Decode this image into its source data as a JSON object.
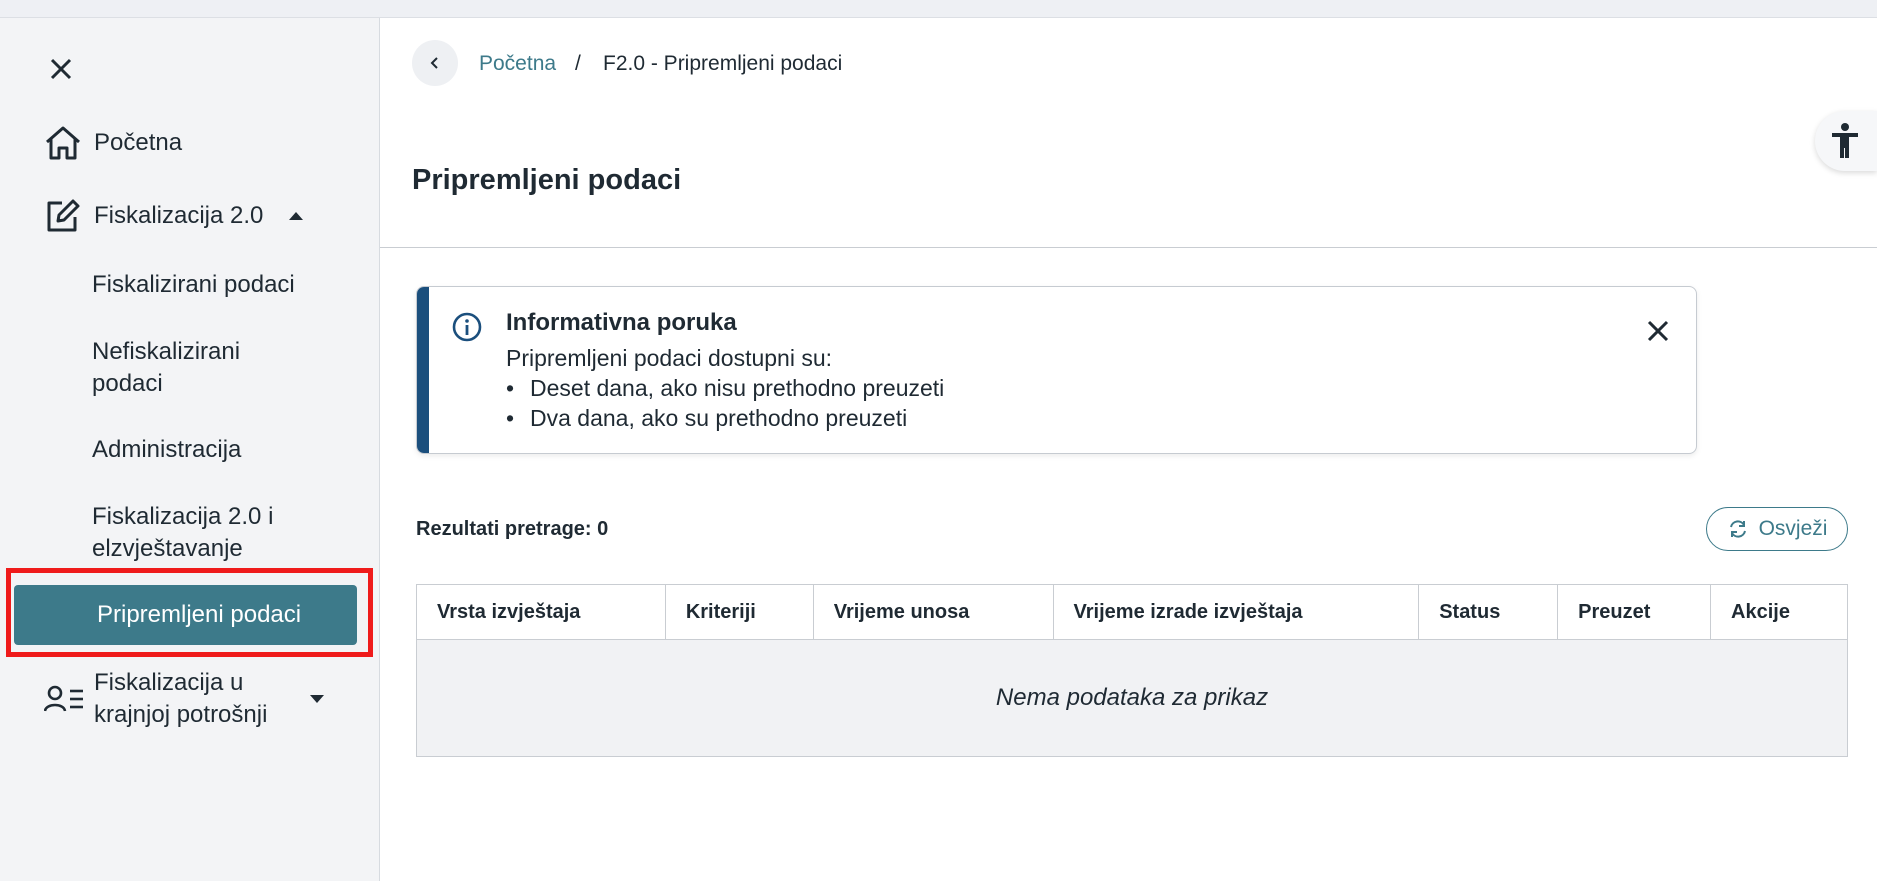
{
  "sidebar": {
    "nav_home": "Početna",
    "nav_fisk20": "Fiskalizacija 2.0",
    "sub_items": [
      "Fiskalizirani podaci",
      "Nefiskalizirani podaci",
      "Administracija",
      "Fiskalizacija 2.0 i elzvještavanje"
    ],
    "active_item": "Pripremljeni podaci",
    "nav_end_consumption": "Fiskalizacija u krajnjoj potrošnji",
    "icons": [
      "close-icon",
      "home-icon",
      "edit-icon",
      "user-list-icon"
    ]
  },
  "breadcrumb": {
    "home": "Početna",
    "separator": "/",
    "current": "F2.0 - Pripremljeni podaci"
  },
  "page": {
    "title": "Pripremljeni podaci"
  },
  "info_message": {
    "title": "Informativna poruka",
    "intro": "Pripremljeni podaci dostupni su:",
    "bullets": [
      "Deset dana, ako nisu prethodno preuzeti",
      "Dva dana, ako su prethodno preuzeti"
    ]
  },
  "results": {
    "label": "Rezultati pretrage: 0",
    "refresh_label": "Osvježi"
  },
  "table": {
    "columns": [
      "Vrsta izvještaja",
      "Kriteriji",
      "Vrijeme unosa",
      "Vrijeme izrade izvještaja",
      "Status",
      "Preuzet",
      "Akcije"
    ],
    "empty_text": "Nema podataka za prikaz"
  },
  "colors": {
    "accent": "#3d7a8a",
    "info_bar": "#1b4f7d",
    "highlight": "#ef1b1b"
  }
}
